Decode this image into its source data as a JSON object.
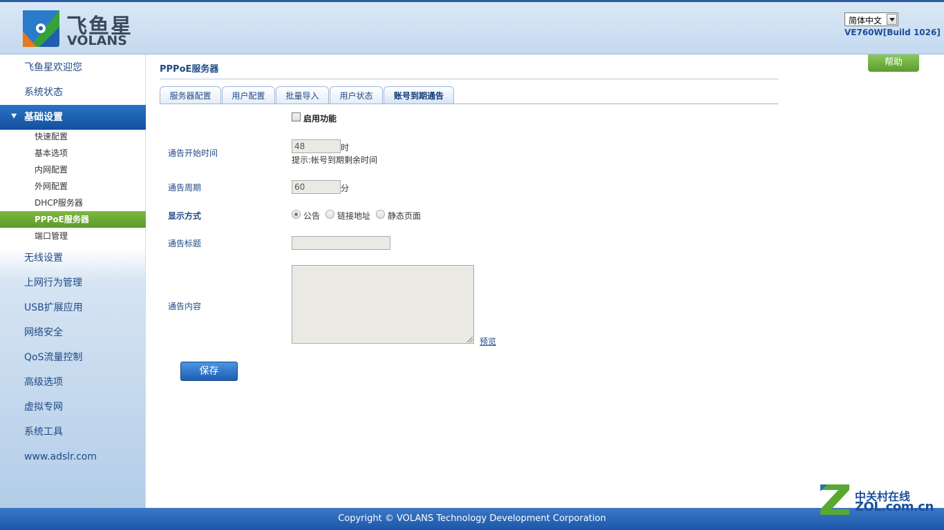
{
  "header": {
    "logo_cn": "飞鱼星",
    "logo_en": "VOLANS",
    "language": "简体中文",
    "version": "VE760W[Build 1026]"
  },
  "sidebar": {
    "items": [
      {
        "label": "飞鱼星欢迎您"
      },
      {
        "label": "系统状态"
      },
      {
        "label": "基础设置",
        "active": true
      },
      {
        "label": "无线设置"
      },
      {
        "label": "上网行为管理"
      },
      {
        "label": "USB扩展应用"
      },
      {
        "label": "网络安全"
      },
      {
        "label": "QoS流量控制"
      },
      {
        "label": "高级选项"
      },
      {
        "label": "虚拟专网"
      },
      {
        "label": "系统工具"
      },
      {
        "label": "www.adslr.com"
      }
    ],
    "sub_items": [
      {
        "label": "快速配置"
      },
      {
        "label": "基本选项"
      },
      {
        "label": "内网配置"
      },
      {
        "label": "外网配置"
      },
      {
        "label": "DHCP服务器"
      },
      {
        "label": "PPPoE服务器",
        "active": true
      },
      {
        "label": "端口管理"
      }
    ]
  },
  "page": {
    "title": "PPPoE服务器",
    "help_label": "帮助",
    "tabs": [
      {
        "label": "服务器配置"
      },
      {
        "label": "用户配置"
      },
      {
        "label": "批量导入"
      },
      {
        "label": "用户状态"
      },
      {
        "label": "账号到期通告",
        "active": true
      }
    ]
  },
  "form": {
    "enable_label": "启用功能",
    "enable_checked": false,
    "start_time": {
      "label": "通告开始时间",
      "value": "48",
      "unit": "时",
      "hint": "提示:帐号到期剩余时间"
    },
    "period": {
      "label": "通告周期",
      "value": "60",
      "unit": "分"
    },
    "display_mode": {
      "label": "显示方式",
      "options": [
        {
          "label": "公告",
          "checked": true
        },
        {
          "label": "链接地址",
          "checked": false
        },
        {
          "label": "静态页面",
          "checked": false
        }
      ]
    },
    "notice_title": {
      "label": "通告标题",
      "value": ""
    },
    "notice_content": {
      "label": "通告内容",
      "value": ""
    },
    "preview_label": "预览",
    "save_label": "保存"
  },
  "footer": {
    "copyright": "Copyright © VOLANS Technology Development Corporation"
  },
  "watermark": {
    "cn": "中关村在线",
    "en": "ZOL.com.cn"
  }
}
